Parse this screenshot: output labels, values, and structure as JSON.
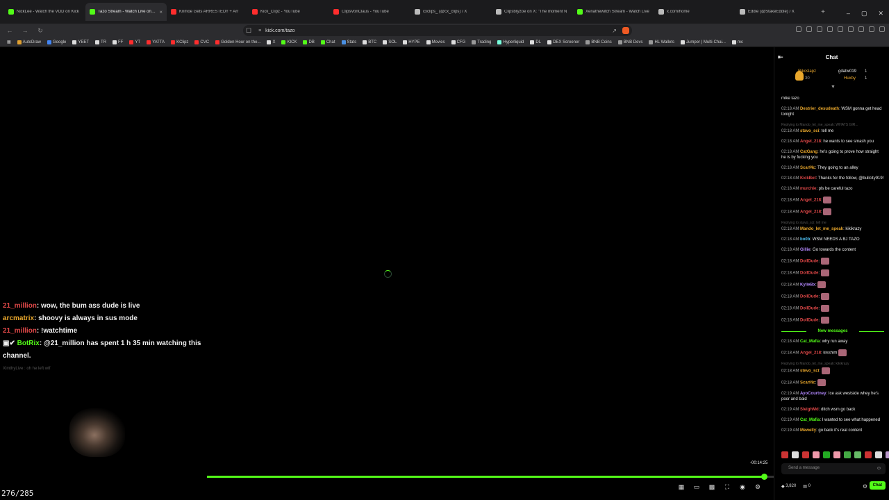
{
  "tabs": [
    {
      "title": "NickLee - Watch the VOD on Kick",
      "color": "#53fc18",
      "active": false
    },
    {
      "title": "Tazo Stream - Watch Live on Kick",
      "color": "#53fc18",
      "active": true
    },
    {
      "title": "Krimoe Gets ARRESTED!! + Arr",
      "color": "#ff2d2d",
      "active": false
    },
    {
      "title": "Kick_Clipz - YouTube",
      "color": "#ff2d2d",
      "active": false
    },
    {
      "title": "ClipsVonClaus - YouTube",
      "color": "#ff2d2d",
      "active": false
    },
    {
      "title": "cxclips_ (@cx_clips) / X",
      "color": "#bbbbbb",
      "active": false
    },
    {
      "title": "Clipsbryzoe on X: \"The moment N",
      "color": "#bbbbbb",
      "active": false
    },
    {
      "title": "Xenathewitch Stream - Watch Live",
      "color": "#53fc18",
      "active": false
    },
    {
      "title": "x.com/home",
      "color": "#bbbbbb",
      "active": false
    },
    {
      "title": "Eddie (@StakeEddie) / X",
      "color": "#bbbbbb",
      "active": false
    }
  ],
  "new_tab": "+",
  "window_controls": [
    "–",
    "▢",
    "✕"
  ],
  "address": {
    "url": "kick.com/tazo"
  },
  "bookmarks": [
    {
      "label": "AutoDraw",
      "color": "#e0a030"
    },
    {
      "label": "Google",
      "color": "#4285f4"
    },
    {
      "label": "YEET",
      "color": "#dddddd"
    },
    {
      "label": "TR",
      "color": "#dddddd"
    },
    {
      "label": "FF",
      "color": "#dddddd"
    },
    {
      "label": "YT",
      "color": "#ff2d2d"
    },
    {
      "label": "YATTA",
      "color": "#ff2d2d"
    },
    {
      "label": "KClipz",
      "color": "#ff2d2d"
    },
    {
      "label": "CVC",
      "color": "#ff2d2d"
    },
    {
      "label": "Golden Hour on the...",
      "color": "#ff2d2d"
    },
    {
      "label": "X",
      "color": "#dddddd"
    },
    {
      "label": "KICK",
      "color": "#53fc18"
    },
    {
      "label": "DB",
      "color": "#53fc18"
    },
    {
      "label": "Chat",
      "color": "#53fc18"
    },
    {
      "label": "Stats",
      "color": "#4a90e2"
    },
    {
      "label": "BTC",
      "color": "#dddddd"
    },
    {
      "label": "SOL",
      "color": "#dddddd"
    },
    {
      "label": "HYPE",
      "color": "#dddddd"
    },
    {
      "label": "Movies",
      "color": "#dddddd"
    },
    {
      "label": "CFG",
      "color": "#dddddd"
    },
    {
      "label": "Trading",
      "color": "#999999"
    },
    {
      "label": "Hyperliquid",
      "color": "#7fd"
    },
    {
      "label": "DL",
      "color": "#dddddd"
    },
    {
      "label": "DEX Screener",
      "color": "#dddddd"
    },
    {
      "label": "BNB Coins",
      "color": "#999999"
    },
    {
      "label": "BNB Devs",
      "color": "#999999"
    },
    {
      "label": "HL Wallets",
      "color": "#999999"
    },
    {
      "label": "Jumper | Multi-Chai...",
      "color": "#dddddd"
    },
    {
      "label": "mc",
      "color": "#dddddd"
    }
  ],
  "overlay_chat": [
    {
      "user": "21_million",
      "user_color": "#e04848",
      "text": ": wow, the bum ass dude is live"
    },
    {
      "user": "arcmatrix",
      "user_color": "#e9a72c",
      "text": ": shoovy is always in sus mode"
    },
    {
      "user": "21_million",
      "user_color": "#e04848",
      "text": ": !watchtime"
    },
    {
      "user": "BotRix",
      "user_color": "#53fc18",
      "text": ": @21_million has spent 1 h 35 min watching this channel."
    }
  ],
  "overlay_faded": "XimthyLive : oh he left wtf",
  "counter": "276/285",
  "time_left": "-00:14:25",
  "progress_fraction": 0.983,
  "chat": {
    "title": "Chat",
    "gifters": {
      "top_name": "Rikoslapz",
      "top_count": "30",
      "second_name": "gdatw019",
      "second_count": "1",
      "third_name": "Huxby",
      "third_count": "1"
    },
    "pinned": "mike tazo",
    "messages": [
      {
        "time": "02:18 AM",
        "user": "Destrier_desudeath",
        "color": "#e9a72c",
        "text": ": WSM gonna get head tonight"
      },
      {
        "reply": "Replying to Mando_let_me_speak: WHATS GIR...",
        "time": "02:18 AM",
        "user": "stavo_sci",
        "color": "#e9a72c",
        "text": ": tell me"
      },
      {
        "time": "02:18 AM",
        "user": "Angel_218",
        "color": "#e04848",
        "text": ": he wants to see smash you"
      },
      {
        "time": "02:18 AM",
        "user": "CatGang",
        "color": "#e9a72c",
        "text": ": he's going to prove how straight he is by fucking you"
      },
      {
        "time": "02:18 AM",
        "user": "Scarf4c",
        "color": "#e9a72c",
        "text": ": They going to an alley"
      },
      {
        "time": "02:18 AM",
        "user": "KickBot",
        "color": "#e04848",
        "text": ": Thanks for the follow, @bullcity919!"
      },
      {
        "time": "02:18 AM",
        "user": "murchie",
        "color": "#e04848",
        "text": ": pls be careful tazo"
      },
      {
        "time": "02:18 AM",
        "user": "Angel_218",
        "color": "#e04848",
        "text": ":",
        "emote": true
      },
      {
        "time": "02:18 AM",
        "user": "Angel_218",
        "color": "#e04848",
        "text": ":",
        "emote": true
      },
      {
        "reply": "Replying to stavo_sci: tell me",
        "time": "02:18 AM",
        "user": "Mando_let_me_speak",
        "color": "#e9a72c",
        "text": ": kikikrazy"
      },
      {
        "time": "02:18 AM",
        "user": "bo0b",
        "color": "#4fc3f7",
        "text": ": WSM NEEDS A BJ TAZO"
      },
      {
        "time": "02:18 AM",
        "user": "Gillie",
        "color": "#b388ff",
        "text": ": Go towards the content"
      },
      {
        "time": "02:18 AM",
        "user": "DollDude",
        "color": "#e04848",
        "text": ":",
        "emote": true
      },
      {
        "time": "02:18 AM",
        "user": "DollDude",
        "color": "#e04848",
        "text": ":",
        "emote": true
      },
      {
        "time": "02:18 AM",
        "user": "KylieBx",
        "color": "#b388ff",
        "text": ":",
        "emote": true
      },
      {
        "time": "02:18 AM",
        "user": "DollDude",
        "color": "#e04848",
        "text": ":",
        "emote": true
      },
      {
        "time": "02:18 AM",
        "user": "DollDude",
        "color": "#e04848",
        "text": ":",
        "emote": true
      },
      {
        "time": "02:18 AM",
        "user": "DollDude",
        "color": "#e04848",
        "text": ":",
        "emote": true
      }
    ],
    "new_messages_label": "New messages",
    "new_messages": [
      {
        "time": "02:18 AM",
        "user": "Cat_Mafia",
        "color": "#53fc18",
        "text": ": why run away"
      },
      {
        "time": "02:18 AM",
        "user": "Angel_218",
        "color": "#e04848",
        "text": ": kisshim",
        "emote": true
      },
      {
        "reply": "Replying to Mando_let_me_speak: kikikrazy",
        "time": "02:18 AM",
        "user": "stevo_sci",
        "color": "#e9a72c",
        "text": ":",
        "emote": true
      },
      {
        "time": "02:18 AM",
        "user": "Scarf4c",
        "color": "#e9a72c",
        "text": ":",
        "emote": true
      },
      {
        "time": "02:19 AM",
        "user": "AyoCourtney",
        "color": "#b388ff",
        "text": ": Ice ask westside whey he's poor and bald"
      },
      {
        "time": "02:19 AM",
        "user": "SleighMd",
        "color": "#e04848",
        "text": ": ditch wsm go back"
      },
      {
        "time": "02:19 AM",
        "user": "Cat_Mafia",
        "color": "#53fc18",
        "text": ": I wanted to see what happened"
      },
      {
        "time": "02:19 AM",
        "user": "Mewelly",
        "color": "#e9a72c",
        "text": ": go back it's real content"
      }
    ],
    "emote_bar_colors": [
      "#c33",
      "#ddd",
      "#c33",
      "#e9a",
      "#2a2",
      "#e9a",
      "#4a4",
      "#6b6",
      "#c33",
      "#ddd",
      "#b9c"
    ],
    "send_placeholder": "Send a message",
    "points": "3,820",
    "zero": "0",
    "chat_button": "Chat"
  }
}
